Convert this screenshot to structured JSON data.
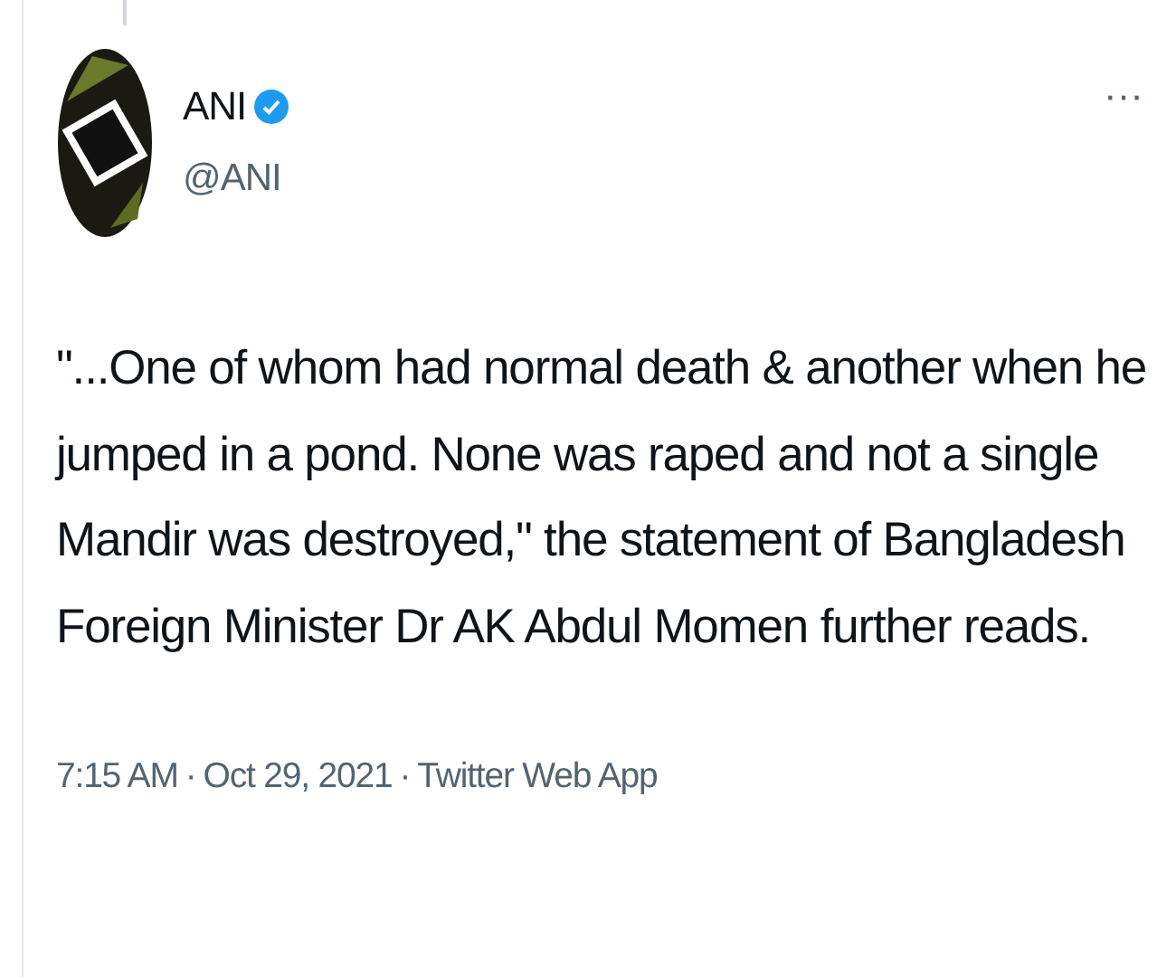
{
  "author": {
    "name": "ANI",
    "handle": "@ANI",
    "verified": true
  },
  "more_menu": "···",
  "tweet_text": "\"...One of whom had normal death & another when he jumped in a pond. None was raped and not a single Mandir was destroyed,\" the statement of Bangladesh Foreign Minister Dr AK Abdul Momen further reads.",
  "meta": {
    "time": "7:15 AM",
    "date": "Oct 29, 2021",
    "source": "Twitter Web App",
    "separator": "·"
  }
}
